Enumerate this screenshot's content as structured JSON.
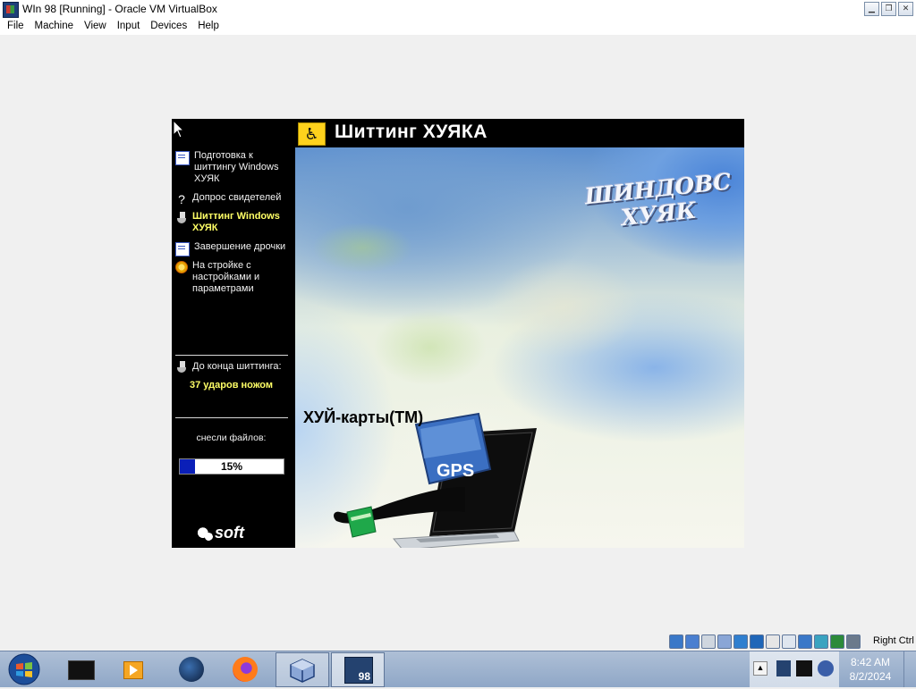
{
  "window": {
    "title": "WIn 98 [Running] - Oracle VM VirtualBox",
    "controls": {
      "minimize": "▁",
      "restore": "❐",
      "close": "✕"
    }
  },
  "menubar": {
    "items": [
      "File",
      "Machine",
      "View",
      "Input",
      "Devices",
      "Help"
    ]
  },
  "vm": {
    "header_title": "Шиттинг ХУЯКА",
    "header_icon": "wheelchair-icon",
    "steps": [
      {
        "label": "Подготовка к шиттингу Windows ХУЯК",
        "icon": "document-icon",
        "active": false
      },
      {
        "label": "Допрос свидетелей",
        "icon": "question-icon",
        "active": false
      },
      {
        "label": "Шиттинг Windows ХУЯК",
        "icon": "toilet-icon",
        "active": true
      },
      {
        "label": "Завершение дрочки",
        "icon": "document-icon",
        "active": false
      },
      {
        "label": "На стройке с настройками и параметрами",
        "icon": "gear-icon",
        "active": false
      }
    ],
    "remaining_label": "До конца шиттинга:",
    "remaining_value": "37 ударов ножом",
    "copied_label": "снесли файлов:",
    "progress_percent": 15,
    "progress_text": "15%",
    "logo_line1": "ШИНДОВС",
    "logo_line2": "ХУЯК",
    "ad_caption": "ХУЙ-карты(ТМ)",
    "ad_badge": "GPS",
    "brand": "soft"
  },
  "tray": {
    "right_ctrl": "Right Ctrl",
    "status_icons": [
      "hard-disk-icon",
      "optical-drive-icon",
      "floppy-icon",
      "audio-icon",
      "network-icon",
      "usb-icon",
      "shared-folder-icon",
      "display-icon",
      "recording-icon",
      "mouse-integration-icon",
      "cpu-icon",
      "settings-icon"
    ]
  },
  "taskbar": {
    "apps": [
      "terminal-app",
      "media-player-app",
      "browser-app",
      "firefox-app",
      "virtualbox-app",
      "win98-vm-app"
    ],
    "active_badge": "98",
    "time": "8:42 AM",
    "date": "8/2/2024"
  }
}
